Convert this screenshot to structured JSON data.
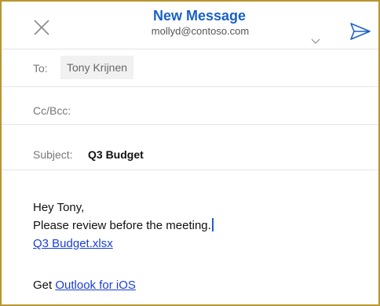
{
  "header": {
    "title": "New Message",
    "account": "mollyd@contoso.com",
    "icons": [
      "close-icon",
      "chevron-down-icon",
      "send-icon"
    ]
  },
  "to": {
    "label": "To:",
    "recipient": "Tony Krijnen"
  },
  "cc": {
    "label": "Cc/Bcc:"
  },
  "subject": {
    "label": "Subject:",
    "value": "Q3 Budget"
  },
  "body": {
    "greeting": "Hey Tony,",
    "message": "Please review before the meeting.",
    "attachment_link": "Q3 Budget.xlsx",
    "signature_prefix": "Get",
    "signature_link": "Outlook for iOS"
  },
  "colors": {
    "accent": "#1a62c4",
    "link": "#1a3fd4",
    "frame_border": "#b8962e"
  }
}
